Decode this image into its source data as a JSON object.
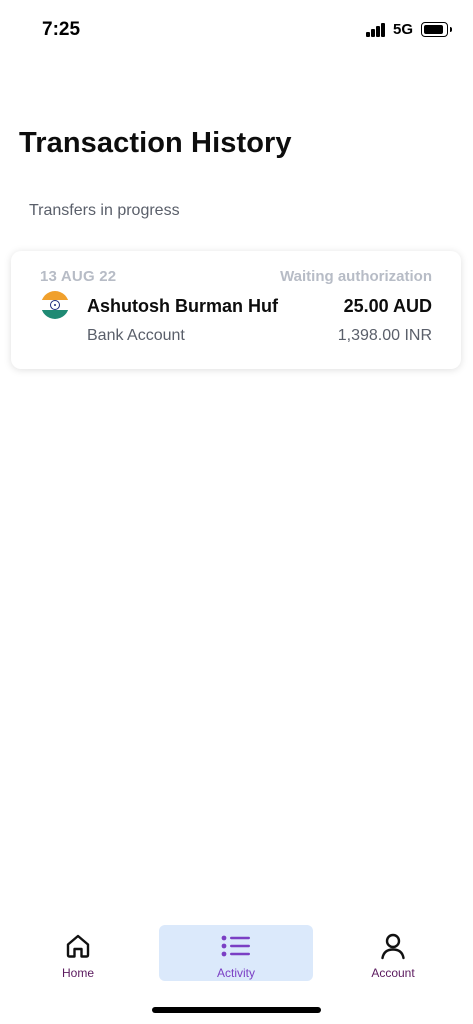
{
  "status_bar": {
    "time": "7:25",
    "network": "5G"
  },
  "page": {
    "title": "Transaction History",
    "section_label": "Transfers in progress"
  },
  "transfers": [
    {
      "date": "13 AUG 22",
      "status": "Waiting authorization",
      "recipient": "Ashutosh Burman Huf",
      "account_type": "Bank Account",
      "send_amount": "25.00 AUD",
      "receive_amount": "1,398.00 INR",
      "flag_icon": "india-flag-icon"
    }
  ],
  "bottom_nav": {
    "items": [
      {
        "label": "Home",
        "icon": "home-icon",
        "active": false
      },
      {
        "label": "Activity",
        "icon": "list-icon",
        "active": true
      },
      {
        "label": "Account",
        "icon": "user-icon",
        "active": false
      }
    ]
  },
  "colors": {
    "nav_label": "#5b1a5e",
    "active_nav_label": "#7b3fc4",
    "active_nav_bg": "#dbe9fb",
    "muted_text": "#b7bcc6",
    "secondary_text": "#5a5f6a",
    "flag_saffron": "#f0a02c",
    "flag_green": "#1f8a74"
  }
}
